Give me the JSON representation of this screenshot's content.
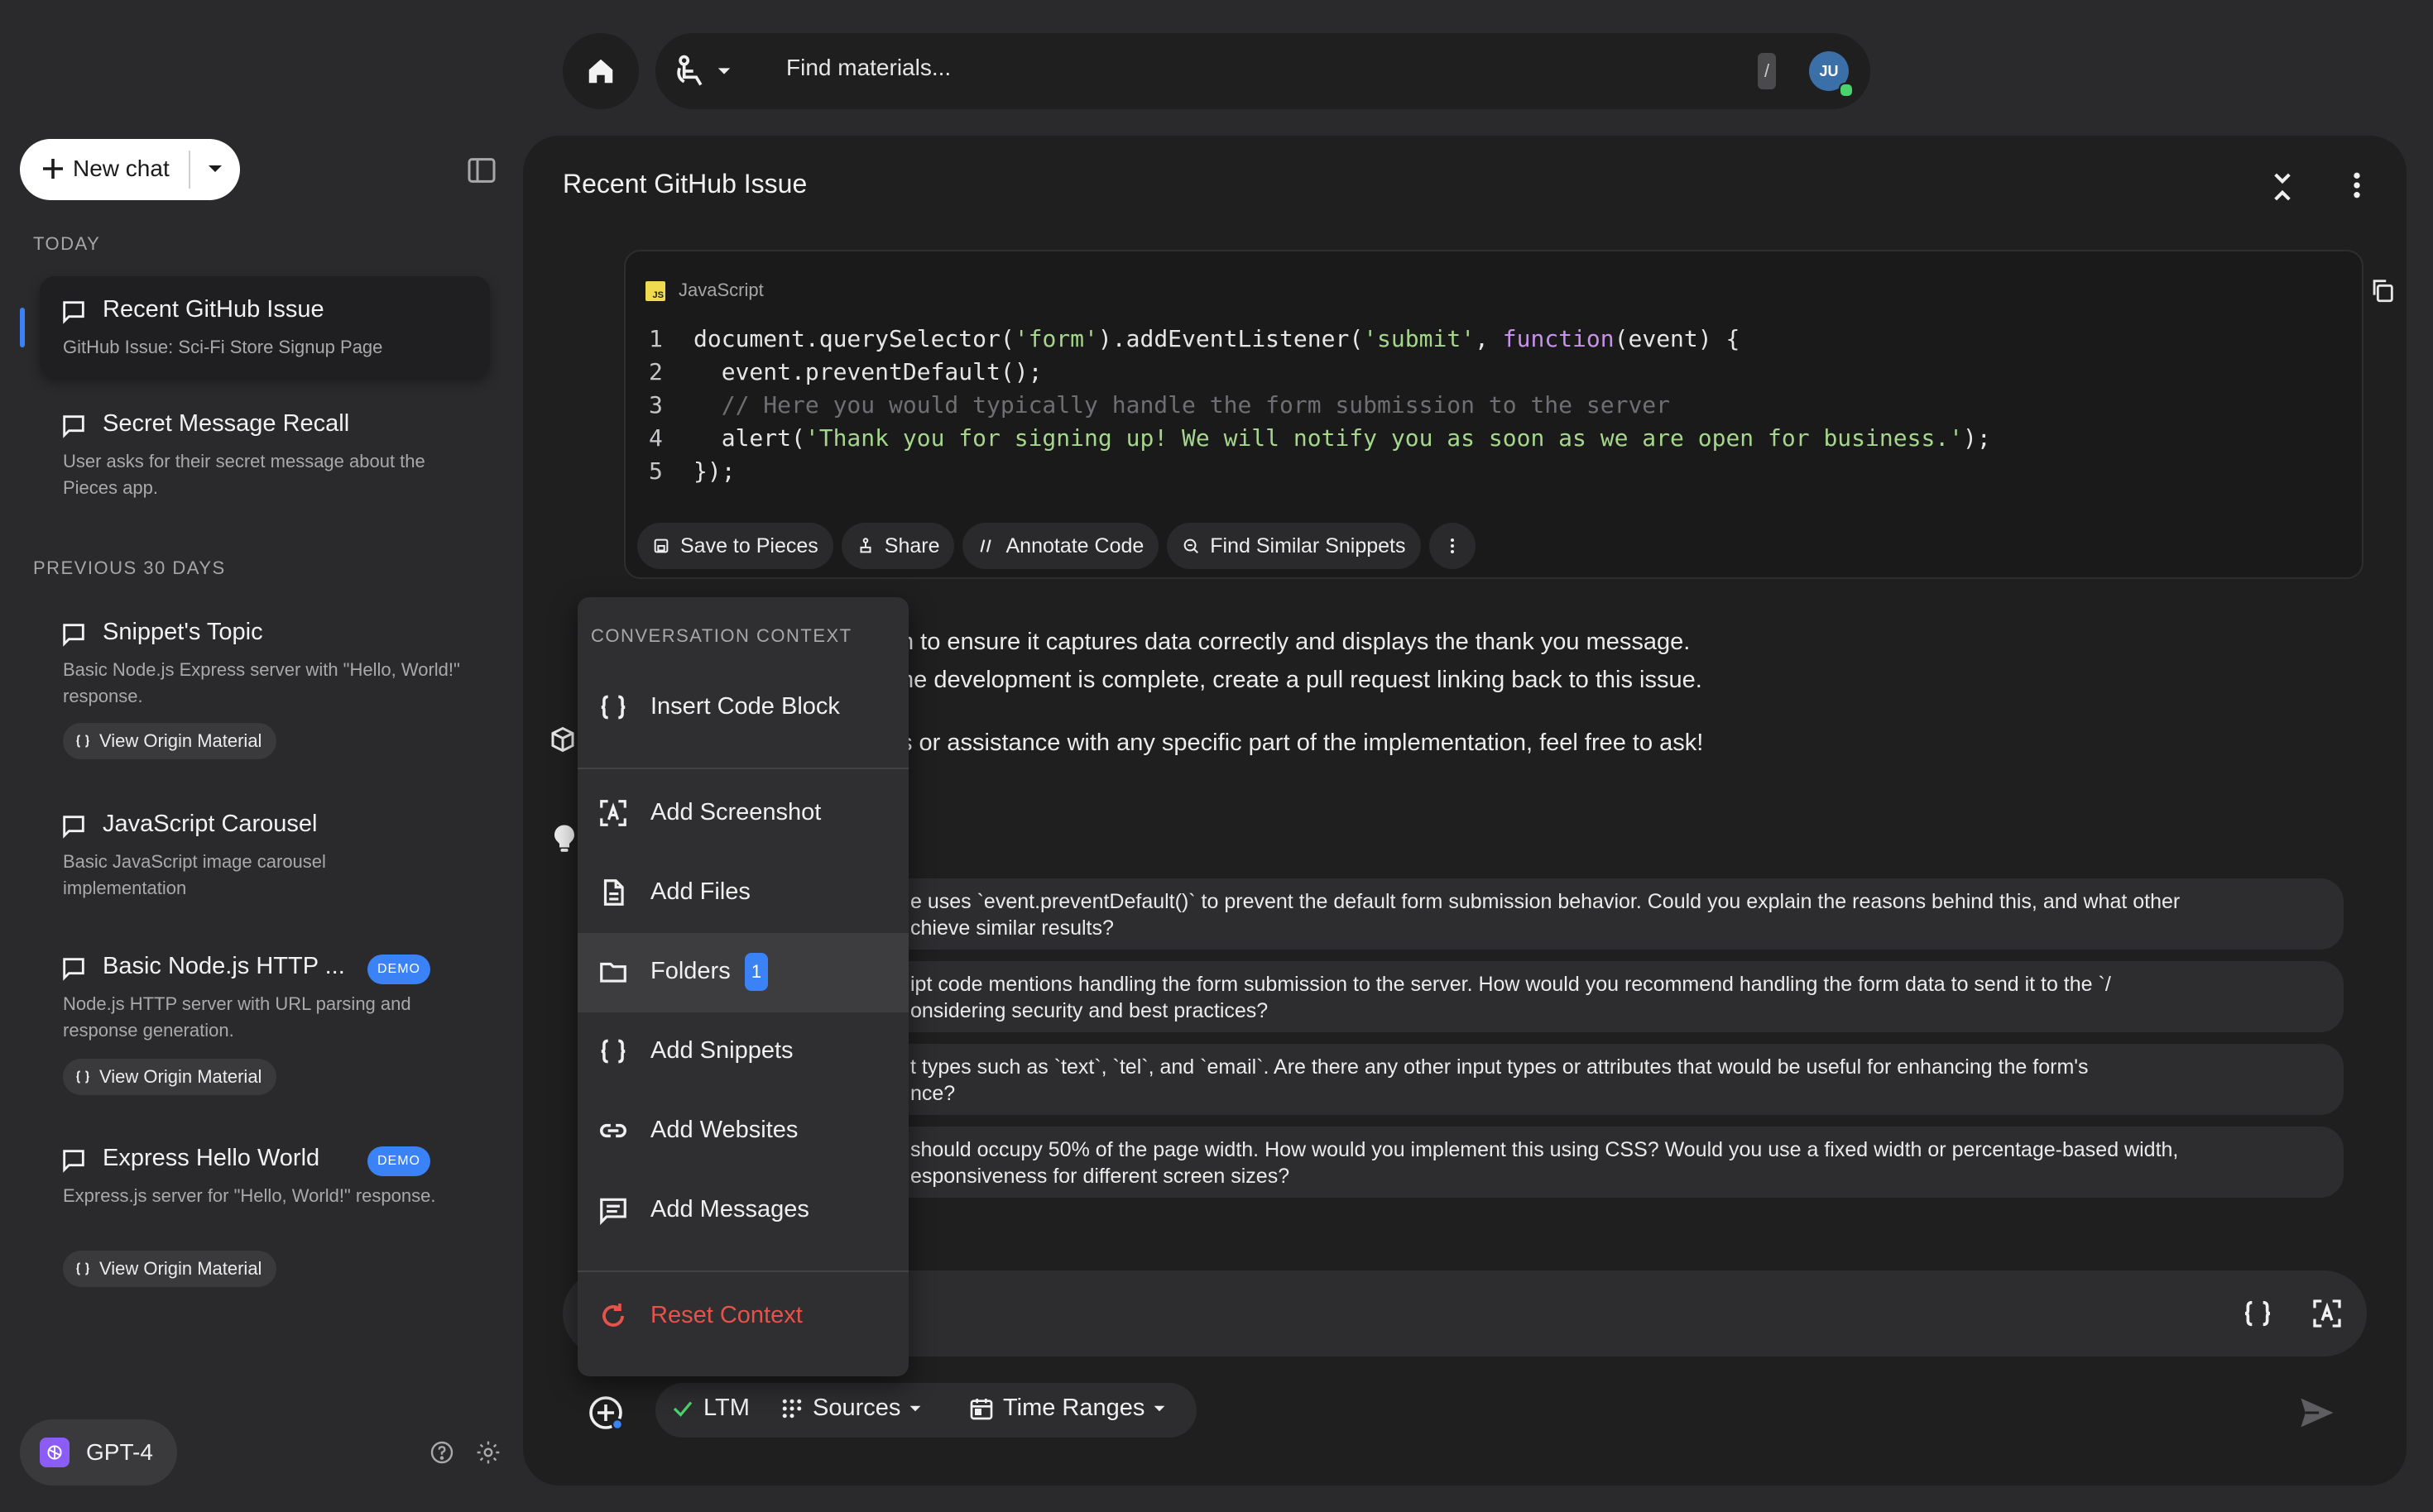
{
  "search": {
    "placeholder": "Find materials...",
    "shortcut": "/"
  },
  "user": {
    "initials": "JU"
  },
  "sidebar": {
    "new_chat_label": "New chat",
    "today_label": "TODAY",
    "previous_label": "PREVIOUS 30 DAYS",
    "today_items": [
      {
        "title": "Recent GitHub Issue",
        "desc": "GitHub Issue: Sci-Fi Store Signup Page"
      },
      {
        "title": "Secret Message Recall",
        "desc": "User asks for their secret message about the Pieces app."
      }
    ],
    "previous_items": [
      {
        "title": "Snippet's Topic",
        "desc": "Basic Node.js Express server with \"Hello, World!\" response.",
        "origin": "View Origin Material"
      },
      {
        "title": "JavaScript Carousel",
        "desc": "Basic JavaScript image carousel implementation"
      },
      {
        "title": "Basic Node.js HTTP ...",
        "badge": "DEMO",
        "desc": "Node.js HTTP server with URL parsing and response generation.",
        "origin": "View Origin Material"
      },
      {
        "title": "Express Hello World",
        "badge": "DEMO",
        "desc": "Express.js server for \"Hello, World!\" response.",
        "origin": "View Origin Material"
      }
    ],
    "model_label": "GPT-4"
  },
  "main": {
    "title": "Recent GitHub Issue",
    "code": {
      "language": "JavaScript",
      "lines": [
        {
          "n": "1",
          "parts": [
            [
              "def",
              "document.querySelector("
            ],
            [
              "str",
              "'form'"
            ],
            [
              "def",
              ").addEventListener("
            ],
            [
              "str",
              "'submit'"
            ],
            [
              "def",
              ", "
            ],
            [
              "kw",
              "function"
            ],
            [
              "def",
              "(event) {"
            ]
          ]
        },
        {
          "n": "2",
          "parts": [
            [
              "def",
              "  event.preventDefault();"
            ]
          ]
        },
        {
          "n": "3",
          "parts": [
            [
              "com",
              "  // Here you would typically handle the form submission to the server"
            ]
          ]
        },
        {
          "n": "4",
          "parts": [
            [
              "def",
              "  alert("
            ],
            [
              "str",
              "'Thank you for signing up! We will notify you as soon as we are open for business.'"
            ],
            [
              "def",
              ");"
            ]
          ]
        },
        {
          "n": "5",
          "parts": [
            [
              "def",
              "});"
            ]
          ]
        }
      ],
      "actions": [
        "Save to Pieces",
        "Share",
        "Annotate Code",
        "Find Similar Snippets"
      ]
    },
    "paragraphs": [
      "n to ensure it captures data correctly and displays the thank you message.",
      "he development is complete, create a pull request linking back to this issue.",
      "s or assistance with any specific part of the implementation, feel free to ask!"
    ],
    "suggestions": [
      {
        "l1": "e uses `event.preventDefault()` to prevent the default form submission behavior. Could you explain the reasons behind this, and what other",
        "l2": "chieve similar results?"
      },
      {
        "l1": "ipt code mentions handling the form submission to the server. How would you recommend handling the form data to send it to the `/",
        "l2": "onsidering security and best practices?"
      },
      {
        "l1": "t types such as `text`, `tel`, and `email`. Are there any other input types or attributes that would be useful for enhancing the form's",
        "l2": "nce?"
      },
      {
        "l1": " should occupy 50% of the page width.  How would you implement this using CSS? Would you use a fixed width or percentage-based width,",
        "l2": "esponsiveness for different screen sizes?"
      }
    ],
    "context_bar": {
      "ltm": "LTM",
      "sources": "Sources",
      "time_ranges": "Time Ranges"
    }
  },
  "context_menu": {
    "header": "CONVERSATION CONTEXT",
    "items": [
      {
        "label": "Insert Code Block",
        "icon": "curly-braces-icon"
      },
      {
        "label": "Add Screenshot",
        "icon": "screenshot-icon"
      },
      {
        "label": "Add Files",
        "icon": "file-icon"
      },
      {
        "label": "Folders",
        "icon": "folder-icon",
        "count": "1"
      },
      {
        "label": "Add Snippets",
        "icon": "curly-braces-icon"
      },
      {
        "label": "Add Websites",
        "icon": "link-icon"
      },
      {
        "label": "Add Messages",
        "icon": "message-icon"
      }
    ],
    "reset": "Reset Context"
  },
  "colors": {
    "accent": "#3b82f6",
    "reset": "#e5534b",
    "code_string": "#a5d68c",
    "code_keyword": "#c792ea"
  }
}
